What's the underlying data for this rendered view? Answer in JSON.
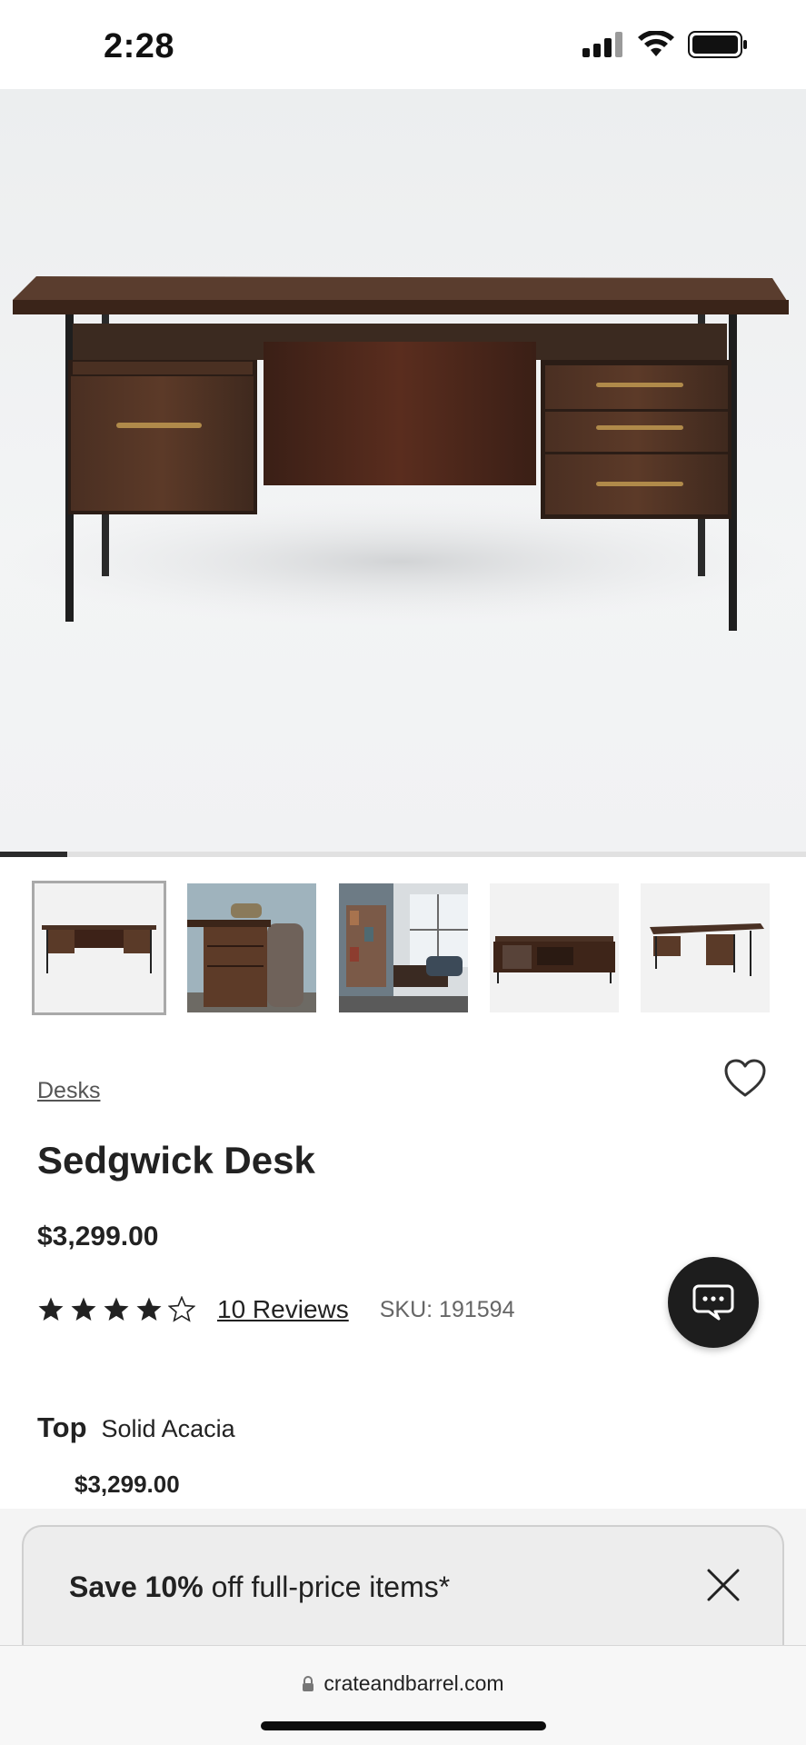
{
  "status_bar": {
    "time": "2:28",
    "icons": [
      "signal-icon",
      "wifi-icon",
      "battery-icon"
    ]
  },
  "hero": {
    "image": "desk-product-photo",
    "gallery_position": 1,
    "gallery_count": 12
  },
  "thumbnails": [
    {
      "name": "desk-front",
      "selected": true
    },
    {
      "name": "desk-lifestyle-chair",
      "selected": false
    },
    {
      "name": "desk-room-scene",
      "selected": false
    },
    {
      "name": "desk-back",
      "selected": false
    },
    {
      "name": "desk-angle",
      "selected": false
    }
  ],
  "product": {
    "category": "Desks",
    "title": "Sedgwick Desk",
    "price": "$3,299.00",
    "rating": 4,
    "rating_max": 5,
    "reviews_label": "10 Reviews",
    "sku_label": "SKU:",
    "sku_value": "191594"
  },
  "option": {
    "label": "Top",
    "value": "Solid Acacia",
    "price": "$3,299.00"
  },
  "promo": {
    "bold": "Save 10%",
    "rest": " off full-price items*"
  },
  "browser": {
    "url": "crateandbarrel.com"
  },
  "colors": {
    "text": "#222222",
    "chat_bg": "#1d1d1d",
    "promo_bg": "#ededed"
  }
}
